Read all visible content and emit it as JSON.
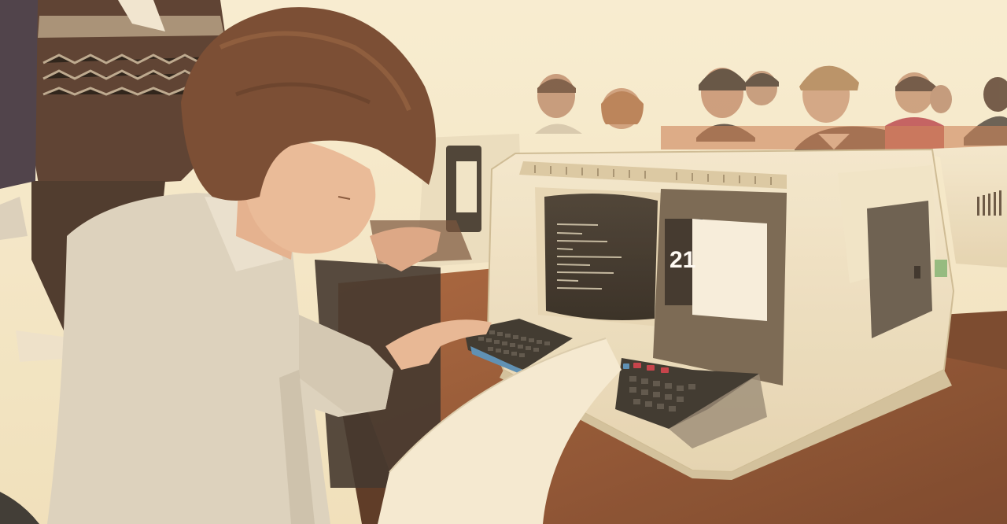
{
  "photo": {
    "station_number": "21",
    "colors": {
      "wall": "#f4ebcf",
      "desk": "#8a4a2a",
      "terminal_body": "#eee3c8",
      "screen": "#2c2622",
      "keyboard": "#2a2724",
      "blue_keys": "#4a88b8",
      "red_keys": "#c03040",
      "shirt": "#d9d2c2",
      "hair": "#6a3d27",
      "sweater": "#4a3026"
    }
  }
}
